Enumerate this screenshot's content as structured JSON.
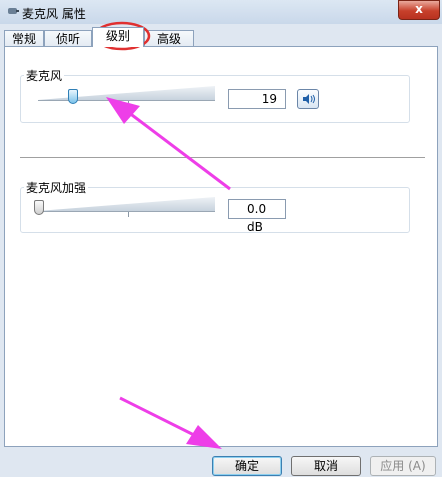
{
  "window": {
    "title": "麦克风 属性",
    "close_label": "x"
  },
  "tabs": [
    {
      "label": "常规",
      "active": false
    },
    {
      "label": "侦听",
      "active": false
    },
    {
      "label": "级别",
      "active": true
    },
    {
      "label": "高级",
      "active": false
    }
  ],
  "microphone": {
    "group_label": "麦克风",
    "level": 19,
    "level_fraction": 0.19,
    "value_text": "19",
    "mute_icon": "speaker-icon"
  },
  "boost": {
    "group_label": "麦克风加强",
    "level_fraction": 0.0,
    "value_text": "0.0 dB"
  },
  "buttons": {
    "ok": "确定",
    "cancel": "取消",
    "apply": "应用 (A)"
  },
  "annotations": {
    "highlight_color": "#e03030",
    "arrow_color": "#ee3ee8"
  }
}
